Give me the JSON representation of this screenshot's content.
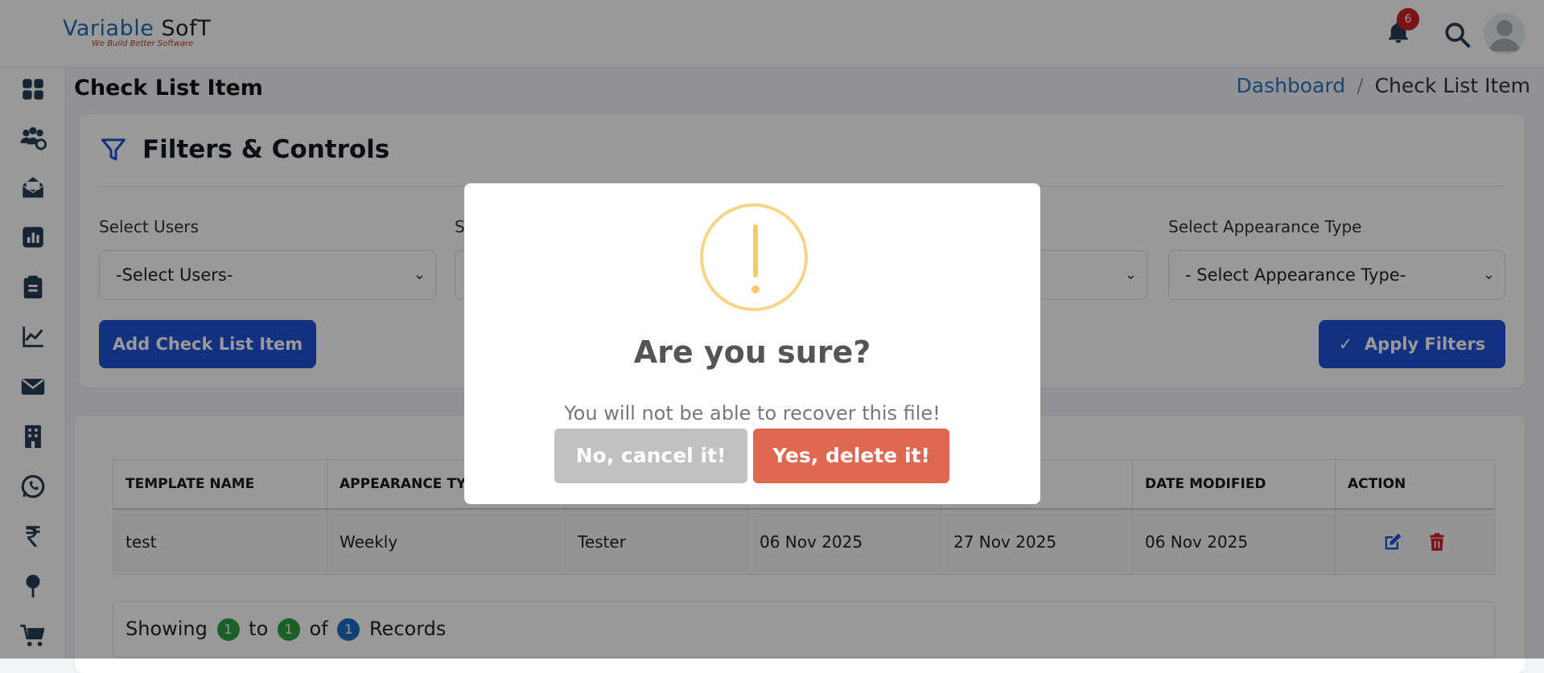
{
  "header": {
    "logo_main": "Variable",
    "logo_accent": "SofT",
    "logo_tagline": "We Build Better Software",
    "notification_count": "6"
  },
  "sidebar": {
    "icons": [
      "dashboard-icon",
      "users-gear-icon",
      "mail-open-icon",
      "report-icon",
      "clipboard-icon",
      "line-chart-icon",
      "envelope-icon",
      "building-icon",
      "whatsapp-icon",
      "rupee-icon",
      "map-pin-icon",
      "cart-icon"
    ]
  },
  "page": {
    "title": "Check List Item",
    "breadcrumb_home": "Dashboard",
    "breadcrumb_sep": "/",
    "breadcrumb_current": "Check List Item"
  },
  "filters": {
    "heading": "Filters & Controls",
    "users_label": "Select Users",
    "users_value": "-Select Users-",
    "second_label_partial": "S",
    "appearance_label": "Select Appearance Type",
    "appearance_value": "- Select Appearance Type-",
    "add_button": "Add Check List Item",
    "apply_button": "Apply Filters"
  },
  "table": {
    "headers": [
      "TEMPLATE NAME",
      "APPEARANCE TYPE",
      "",
      "",
      "",
      "DATE MODIFIED",
      "ACTION"
    ],
    "rows": [
      [
        "test",
        "Weekly",
        "Tester",
        "06 Nov 2025",
        "27 Nov 2025",
        "06 Nov 2025"
      ]
    ]
  },
  "pagination": {
    "showing": "Showing",
    "from": "1",
    "to_word": "to",
    "to": "1",
    "of_word": "of",
    "total": "1",
    "records": "Records"
  },
  "modal": {
    "title": "Are you sure?",
    "text": "You will not be able to recover this file!",
    "cancel": "No, cancel it!",
    "confirm": "Yes, delete it!"
  },
  "colors": {
    "primary": "#1f53d6",
    "danger": "#e0674f",
    "cancel": "#c1c1c1",
    "warning": "#f8d486",
    "badge": "#d0212a",
    "pill_green": "#2f9e44",
    "pill_blue": "#1c6ec0"
  }
}
